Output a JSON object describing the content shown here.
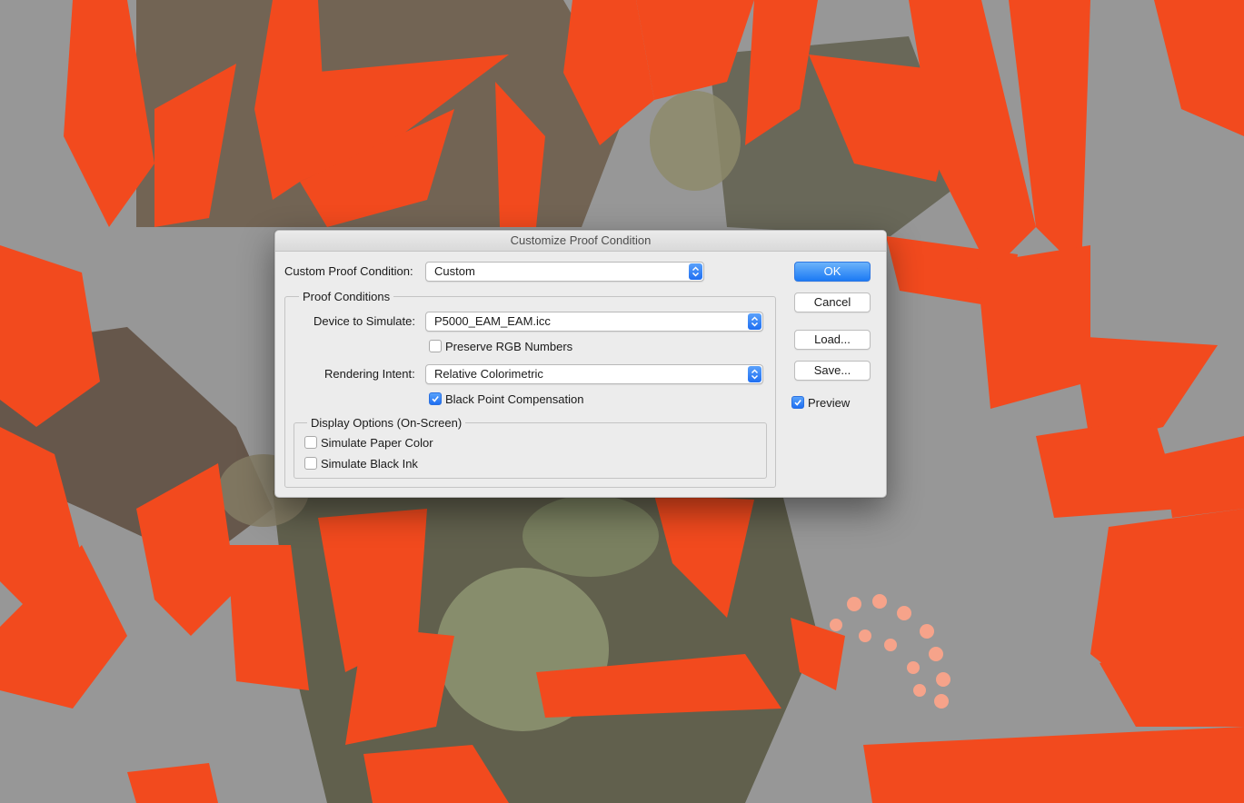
{
  "dialog": {
    "title": "Customize Proof Condition",
    "custom_condition_label": "Custom Proof Condition:",
    "custom_condition_value": "Custom",
    "proof_conditions_title": "Proof Conditions",
    "device_label": "Device to Simulate:",
    "device_value": "P5000_EAM_EAM.icc",
    "preserve_rgb_label": "Preserve RGB Numbers",
    "preserve_rgb_checked": false,
    "rendering_intent_label": "Rendering Intent:",
    "rendering_intent_value": "Relative Colorimetric",
    "black_point_label": "Black Point Compensation",
    "black_point_checked": true,
    "display_options_title": "Display Options (On-Screen)",
    "simulate_paper_label": "Simulate Paper Color",
    "simulate_paper_checked": false,
    "simulate_ink_label": "Simulate Black Ink",
    "simulate_ink_checked": false,
    "ok_label": "OK",
    "cancel_label": "Cancel",
    "load_label": "Load...",
    "save_label": "Save...",
    "preview_label": "Preview",
    "preview_checked": true
  },
  "colors": {
    "accent": "#1f6ff2",
    "background_gray": "#979797",
    "petal_red": "#f2461e"
  }
}
